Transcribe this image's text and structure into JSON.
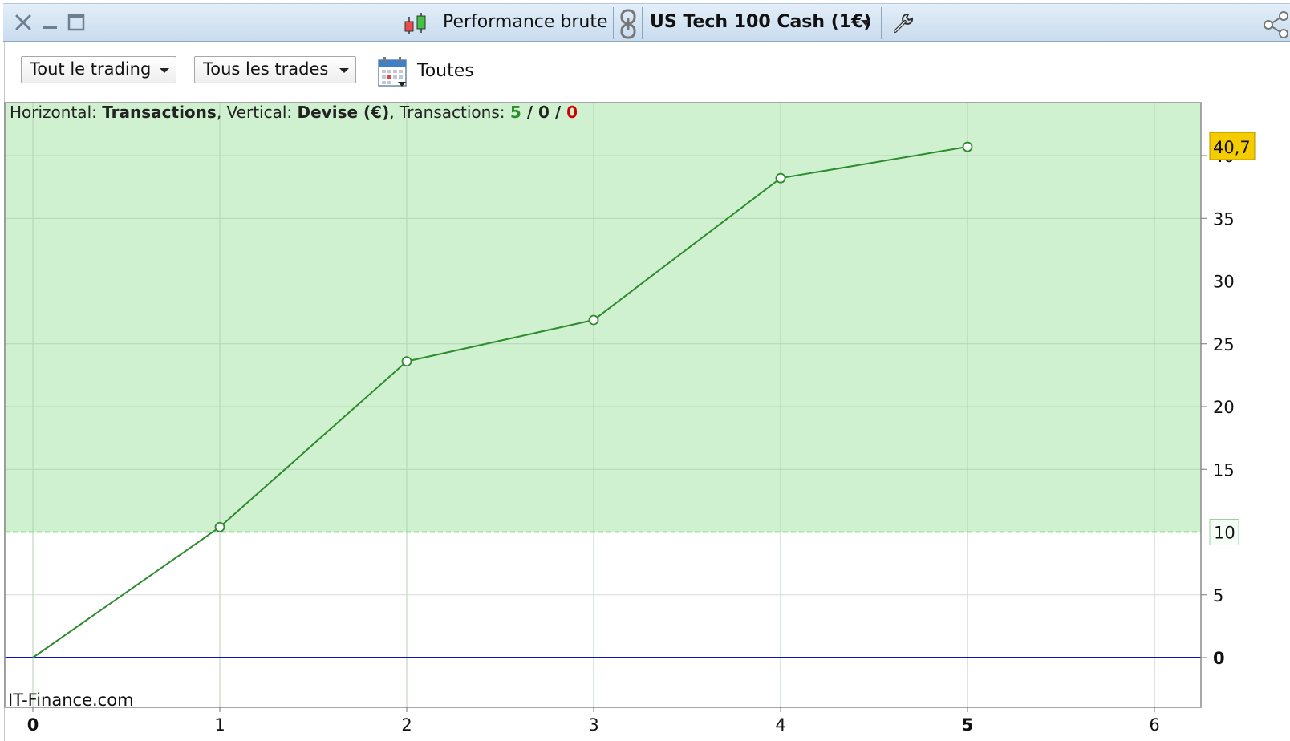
{
  "window": {
    "performance_label": "Performance brute",
    "instrument_label": "US Tech 100 Cash (1€)"
  },
  "toolbar": {
    "trading_dropdown": "Tout le trading",
    "trades_dropdown": "Tous les trades",
    "period_label": "Toutes"
  },
  "header": {
    "horizontal_label": "Horizontal: ",
    "horizontal_value": "Transactions",
    "vertical_label": ", Vertical: ",
    "vertical_value": "Devise (€)",
    "transactions_label": ", Transactions: ",
    "winners": "5",
    "sep1": " / ",
    "neutral": "0",
    "sep2": " / ",
    "losers": "0"
  },
  "watermark": "IT-Finance.com",
  "colors": {
    "profit_zone": "#cff1cf",
    "line": "#2e8b2e",
    "baseline": "#1010c0",
    "threshold": "#4cc84c",
    "last_value_badge": "#f5cc00",
    "winners": "#2e8b2e",
    "losers": "#cc0000"
  },
  "chart_data": {
    "type": "line",
    "xlabel": "Transactions",
    "ylabel": "Devise (€)",
    "x": [
      0,
      1,
      2,
      3,
      4,
      5
    ],
    "values": [
      0,
      10.4,
      23.6,
      26.9,
      38.2,
      40.7
    ],
    "x_ticks": [
      "0",
      "1",
      "2",
      "3",
      "4",
      "5",
      "6"
    ],
    "y_ticks": [
      "0",
      "5",
      "10",
      "15",
      "20",
      "25",
      "30",
      "35",
      "40"
    ],
    "xlim": [
      0,
      6.3
    ],
    "ylim": [
      -4,
      44
    ],
    "threshold": 10,
    "threshold_label": "10",
    "last_value_label": "40,7",
    "grid": true
  }
}
